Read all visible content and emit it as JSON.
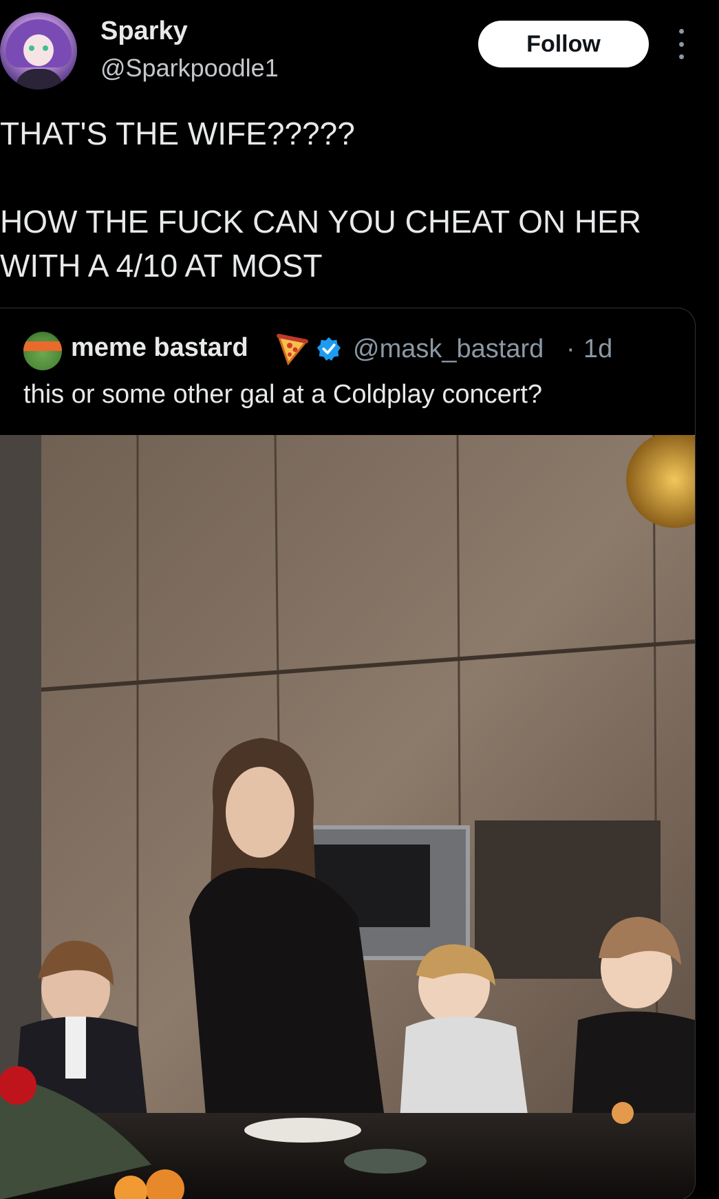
{
  "author": {
    "display_name": "Sparky",
    "handle": "@Sparkpoodle1",
    "avatar_icon": "anime-avatar"
  },
  "actions": {
    "follow_label": "Follow",
    "more_icon": "more-vertical-icon"
  },
  "tweet": {
    "text": "THAT'S THE WIFE?????\n\nHOW THE FUCK CAN YOU CHEAT ON HER\nWITH A 4/10 AT MOST"
  },
  "quoted_tweet": {
    "display_name": "meme bastard",
    "name_emoji": "pizza-icon",
    "verified_icon": "verified-badge-icon",
    "handle": "@mask_bastard",
    "separator": "·",
    "time": "1d",
    "text": "this or some other gal at a Coldplay concert?",
    "media": "photo of a woman and three children at a kitchen counter"
  },
  "colors": {
    "background": "#000000",
    "text_primary": "#e7e9ea",
    "text_secondary": "#8b98a5",
    "verified": "#1d9bf0",
    "border": "#2f3336",
    "follow_bg": "#ffffff"
  }
}
